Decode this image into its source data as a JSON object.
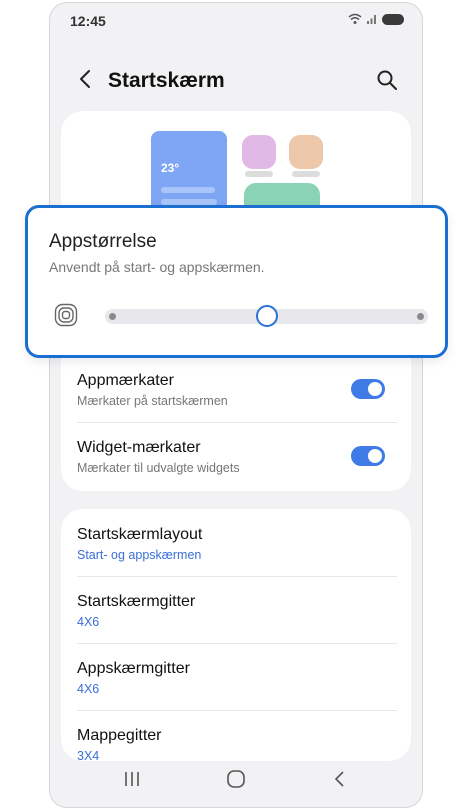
{
  "status": {
    "time": "12:45"
  },
  "header": {
    "title": "Startskærm"
  },
  "preview": {
    "temperature": "23°"
  },
  "popup": {
    "title": "Appstørrelse",
    "subtitle": "Anvendt på start- og appskærmen.",
    "slider_value": 0.5
  },
  "toggles": [
    {
      "title": "Appmærkater",
      "subtitle": "Mærkater på startskærmen",
      "on": true
    },
    {
      "title": "Widget-mærkater",
      "subtitle": "Mærkater til udvalgte widgets",
      "on": true
    }
  ],
  "layout_items": [
    {
      "title": "Startskærmlayout",
      "value": "Start- og appskærmen"
    },
    {
      "title": "Startskærmgitter",
      "value": "4X6"
    },
    {
      "title": "Appskærmgitter",
      "value": "4X6"
    },
    {
      "title": "Mappegitter",
      "value": "3X4"
    }
  ],
  "colors": {
    "accent": "#3e7be6",
    "highlight_border": "#1a6fd1"
  }
}
